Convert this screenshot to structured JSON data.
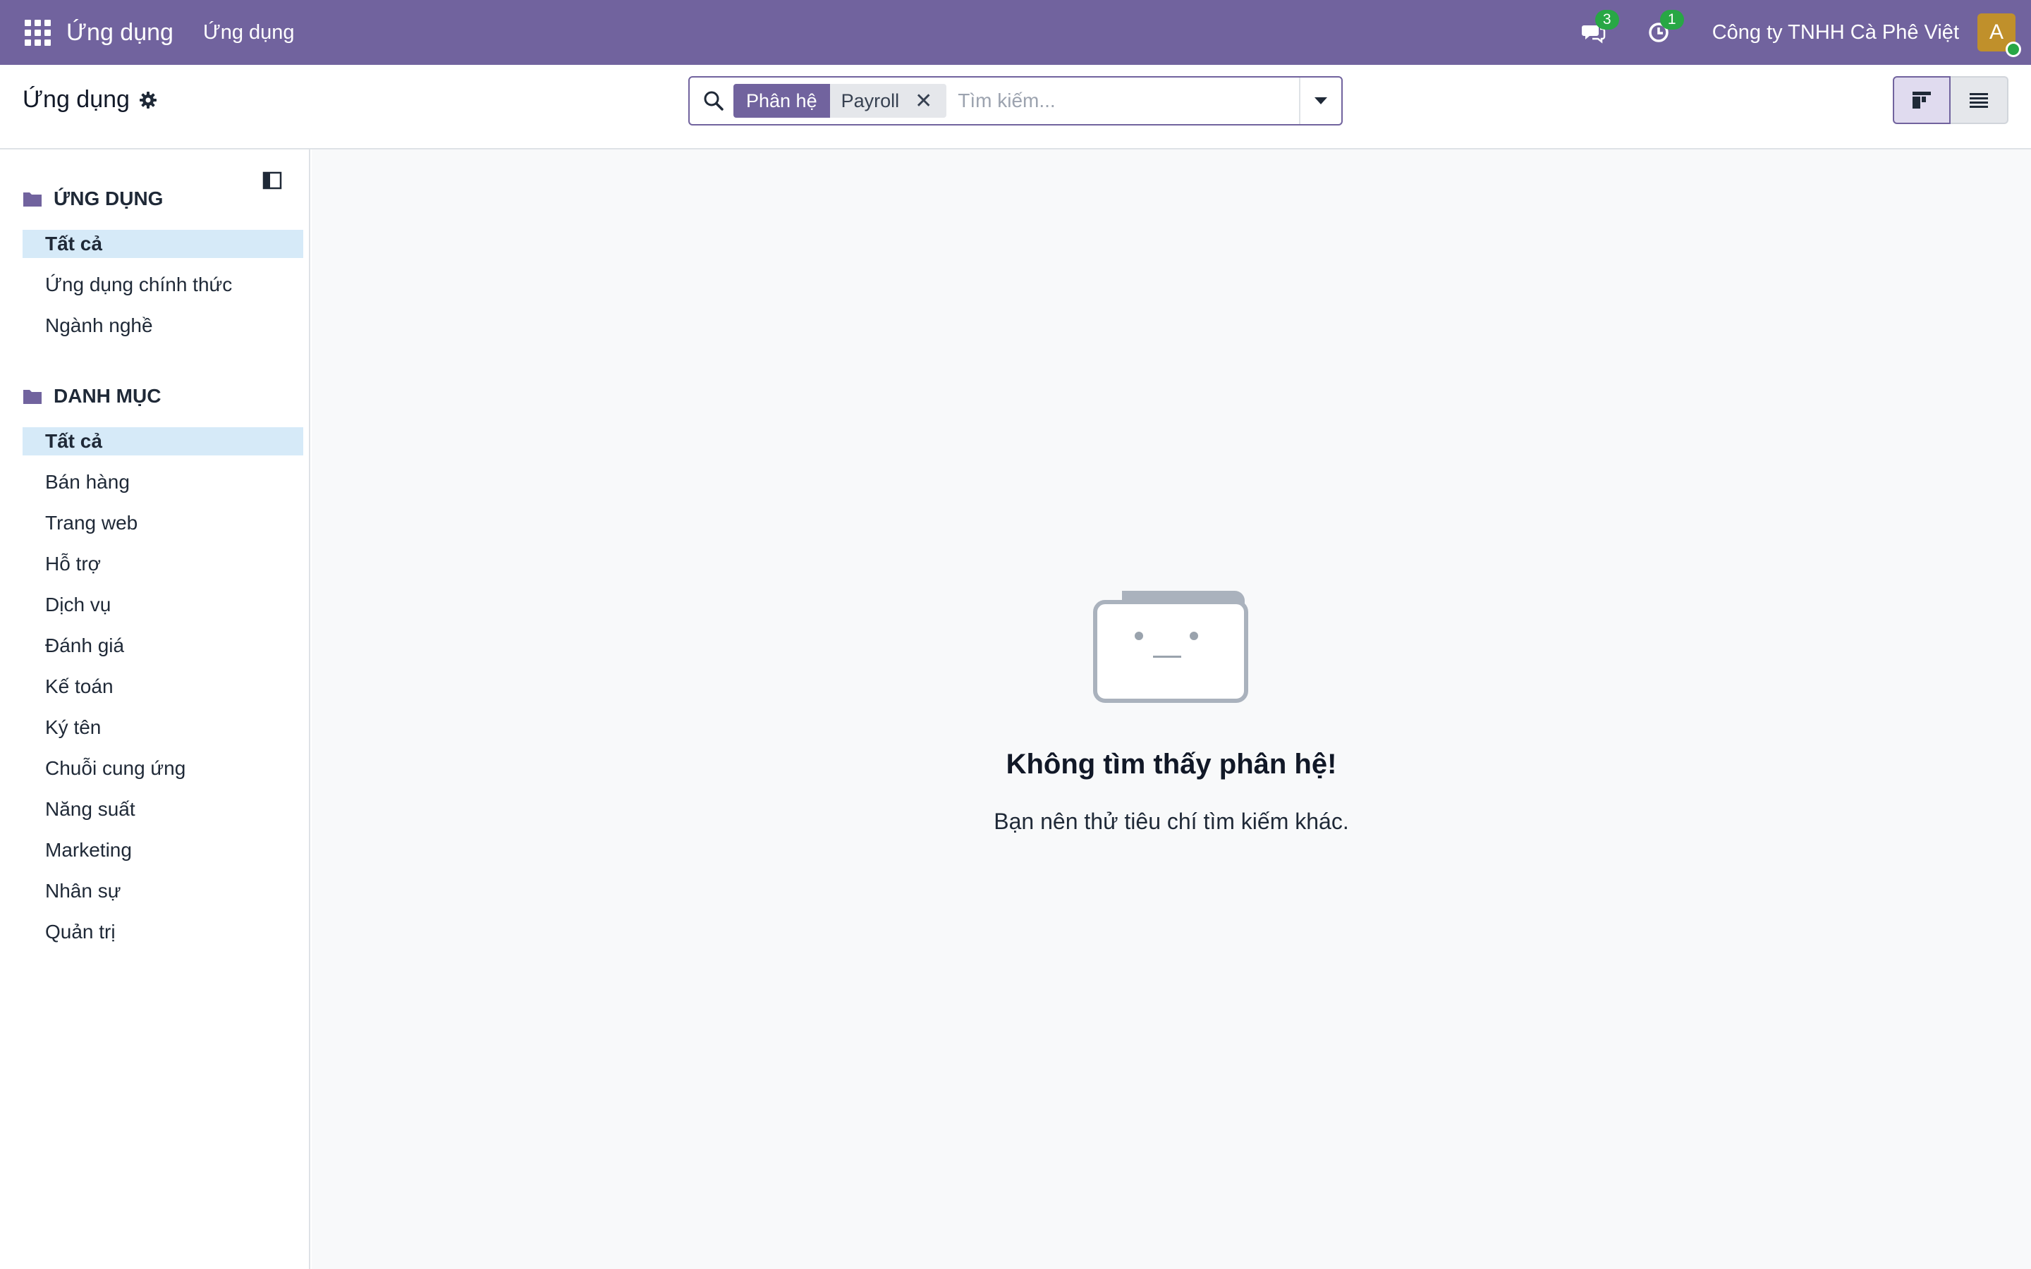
{
  "navbar": {
    "brand": "Ứng dụng",
    "menu_item": "Ứng dụng",
    "messages_count": "3",
    "activities_count": "1",
    "company": "Công ty TNHH Cà Phê Việt",
    "avatar_initial": "A",
    "color": "#71639e"
  },
  "control_panel": {
    "title": "Ứng dụng",
    "search": {
      "facet_label": "Phân hệ",
      "facet_value": "Payroll",
      "placeholder": "Tìm kiếm..."
    }
  },
  "sidebar": {
    "sections": [
      {
        "title": "ỨNG DỤNG",
        "items": [
          "Tất cả",
          "Ứng dụng chính thức",
          "Ngành nghề"
        ],
        "active": "Tất cả"
      },
      {
        "title": "DANH MỤC",
        "items": [
          "Tất cả",
          "Bán hàng",
          "Trang web",
          "Hỗ trợ",
          "Dịch vụ",
          "Đánh giá",
          "Kế toán",
          "Ký tên",
          "Chuỗi cung ứng",
          "Năng suất",
          "Marketing",
          "Nhân sự",
          "Quản trị"
        ],
        "active": "Tất cả"
      }
    ]
  },
  "main": {
    "empty_title": "Không tìm thấy phân hệ!",
    "empty_text": "Bạn nên thử tiêu chí tìm kiếm khác."
  }
}
